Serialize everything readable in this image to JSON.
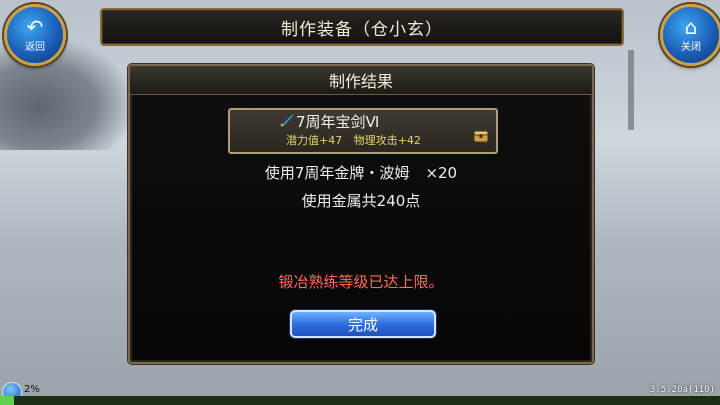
{
  "header": {
    "title": "制作装备（仓小玄）"
  },
  "nav": {
    "back_label": "返回",
    "close_label": "关闭"
  },
  "dialog": {
    "title": "制作结果",
    "item": {
      "name": "7周年宝剑Ⅵ",
      "stat_potential": "潜力值+47",
      "stat_attack": "物理攻击+42",
      "icon": "sword-icon"
    },
    "materials": {
      "line1_text": "使用7周年金牌・波姆",
      "line1_qty": "×20",
      "line2_text": "使用金属共240点"
    },
    "warning": "锻冶熟练等级已达上限。",
    "confirm_label": "完成"
  },
  "status": {
    "progress_text": "2%",
    "progress_value": 0.02,
    "version": "3.5.20a(110)"
  },
  "colors": {
    "accent": "#2f6fe0",
    "warning": "#ff6a5a",
    "stats": "#e7d36a",
    "frame": "#b19c78"
  }
}
